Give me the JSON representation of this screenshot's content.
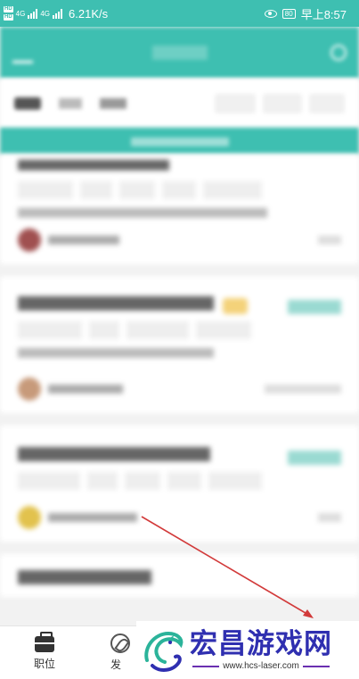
{
  "status_bar": {
    "hd_badge_1": "HD",
    "hd_badge_2": "HD",
    "net_1": "4G",
    "net_2": "4G",
    "speed": "6.21K/s",
    "battery": "80",
    "time": "早上8:57"
  },
  "bottom_nav": {
    "items": [
      {
        "label": "职位"
      },
      {
        "label": "发"
      }
    ]
  },
  "watermark": {
    "title": "宏昌游戏网",
    "url": "www.hcs-laser.com"
  },
  "colors": {
    "brand": "#3ebfb1",
    "annotation_arrow": "#d23a3a",
    "watermark_text": "#2f2fb0"
  }
}
